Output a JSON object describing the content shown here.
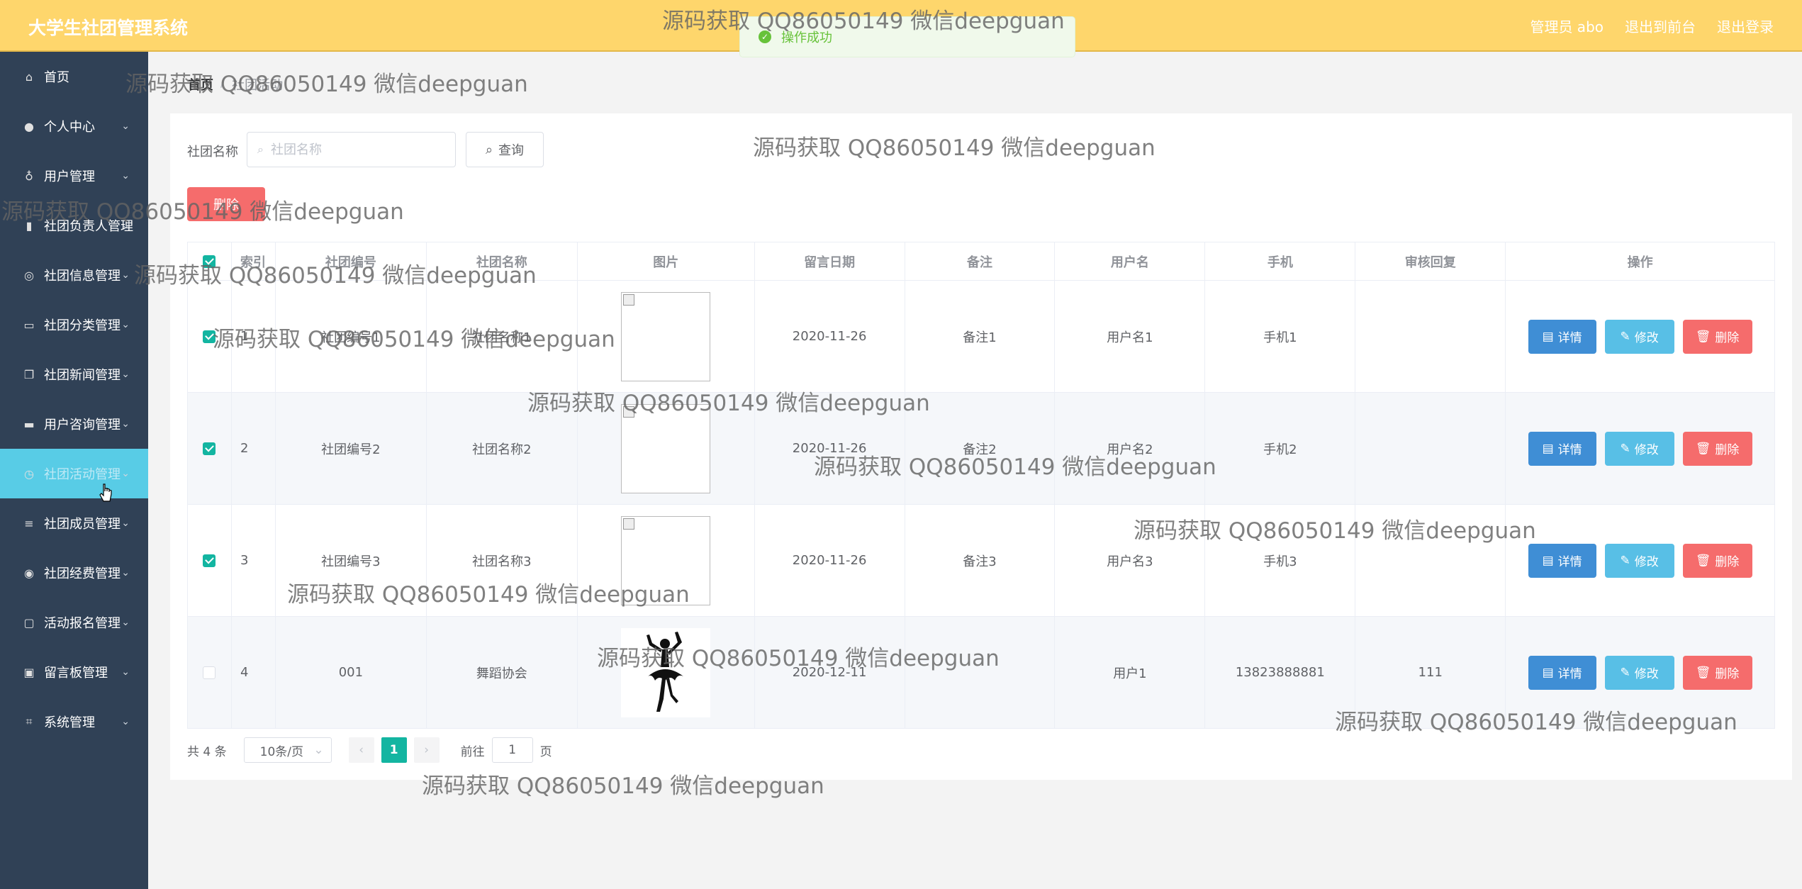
{
  "app": {
    "title": "大学生社团管理系统"
  },
  "header": {
    "user_label": "管理员 abo",
    "front_link": "退出到前台",
    "logout_link": "退出登录"
  },
  "toast": {
    "message": "操作成功"
  },
  "sidebar": {
    "items": [
      {
        "label": "首页",
        "icon": "home-icon"
      },
      {
        "label": "个人中心",
        "icon": "user-icon"
      },
      {
        "label": "用户管理",
        "icon": "mic-icon"
      },
      {
        "label": "社团负责人管理",
        "icon": "bar-chart-icon"
      },
      {
        "label": "社团信息管理",
        "icon": "circle-icon"
      },
      {
        "label": "社团分类管理",
        "icon": "monitor-icon"
      },
      {
        "label": "社团新闻管理",
        "icon": "copy-icon"
      },
      {
        "label": "用户咨询管理",
        "icon": "chat-icon"
      },
      {
        "label": "社团活动管理",
        "icon": "clock-icon"
      },
      {
        "label": "社团成员管理",
        "icon": "list-icon"
      },
      {
        "label": "社团经费管理",
        "icon": "target-icon"
      },
      {
        "label": "活动报名管理",
        "icon": "message-icon"
      },
      {
        "label": "留言板管理",
        "icon": "box-icon"
      },
      {
        "label": "系统管理",
        "icon": "crop-icon"
      }
    ],
    "active_index": 8
  },
  "breadcrumb": {
    "home": "首页",
    "current": "社团活动"
  },
  "search": {
    "label": "社团名称",
    "placeholder": "社团名称",
    "value": "",
    "button": "查询"
  },
  "batch_delete": "删除",
  "table": {
    "headers": [
      "索引",
      "社团编号",
      "社团名称",
      "图片",
      "留言日期",
      "备注",
      "用户名",
      "手机",
      "审核回复",
      "操作"
    ],
    "rows": [
      {
        "checked": true,
        "index": "1",
        "code": "社团编号1",
        "name": "社团名称1",
        "image": "broken",
        "date": "2020-11-26",
        "note": "备注1",
        "username": "用户名1",
        "phone": "手机1",
        "reply": ""
      },
      {
        "checked": true,
        "index": "2",
        "code": "社团编号2",
        "name": "社团名称2",
        "image": "broken",
        "date": "2020-11-26",
        "note": "备注2",
        "username": "用户名2",
        "phone": "手机2",
        "reply": ""
      },
      {
        "checked": true,
        "index": "3",
        "code": "社团编号3",
        "name": "社团名称3",
        "image": "broken",
        "date": "2020-11-26",
        "note": "备注3",
        "username": "用户名3",
        "phone": "手机3",
        "reply": ""
      },
      {
        "checked": false,
        "index": "4",
        "code": "001",
        "name": "舞蹈协会",
        "image": "dancer",
        "date": "2020-12-11",
        "note": "",
        "username": "用户1",
        "phone": "13823888881",
        "reply": "111"
      }
    ],
    "ops": {
      "detail": "详情",
      "edit": "修改",
      "delete": "删除"
    }
  },
  "pagination": {
    "total": "共 4 条",
    "page_size": "10条/页",
    "current_page": "1",
    "goto_label": "前往",
    "goto_value": "1",
    "page_suffix": "页"
  },
  "watermark": "源码获取 QQ86050149 微信deepguan",
  "colors": {
    "header": "#fed66c",
    "sidebar": "#304156",
    "sidebar_active": "#58cce6",
    "primary": "#13b5a1",
    "danger": "#f56c6c",
    "info": "#3f8ed5"
  }
}
